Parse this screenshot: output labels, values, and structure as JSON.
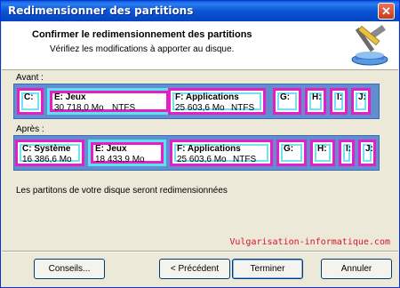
{
  "window": {
    "title": "Redimensionner des partitions",
    "close_symbol": "✕"
  },
  "header": {
    "title": "Confirmer le redimensionnement des partitions",
    "subtitle": "Vérifiez les modifications à apporter au disque."
  },
  "before": {
    "label": "Avant :",
    "partitions": [
      {
        "label": "C:",
        "size": "",
        "fs": ""
      },
      {
        "label": "E:  Jeux",
        "size": "30 718,0 Mo",
        "fs": "NTFS"
      },
      {
        "label": "F:  Applications",
        "size": "25 603,6 Mo",
        "fs": "NTFS"
      },
      {
        "label": "G:",
        "size": "",
        "fs": ""
      },
      {
        "label": "H:",
        "size": "",
        "fs": ""
      },
      {
        "label": "I:",
        "size": "",
        "fs": ""
      },
      {
        "label": "J:",
        "size": "",
        "fs": ""
      }
    ]
  },
  "after": {
    "label": "Après :",
    "partitions": [
      {
        "label": "C:  Système",
        "size": "16 386,6 Mo",
        "fs": ""
      },
      {
        "label": "E:  Jeux",
        "size": "18 433,9 Mo",
        "fs": ""
      },
      {
        "label": "F:  Applications",
        "size": "25 603,6 Mo",
        "fs": "NTFS"
      },
      {
        "label": "G:",
        "size": "",
        "fs": ""
      },
      {
        "label": "H:",
        "size": "",
        "fs": ""
      },
      {
        "label": "I:",
        "size": "",
        "fs": ""
      },
      {
        "label": "J:",
        "size": "",
        "fs": ""
      }
    ]
  },
  "info_text": "Les partitons de votre disque seront redimensionnées",
  "watermark": "Vulgarisation-informatique.com",
  "buttons": {
    "tips": "Conseils...",
    "back": "< Précédent",
    "finish": "Terminer",
    "cancel": "Annuler"
  },
  "colors": {
    "partition_border": "#e41fc4",
    "partition_inner": "#74e0f0",
    "disk_strip": "#5f8fcf",
    "watermark": "#d7142c"
  }
}
